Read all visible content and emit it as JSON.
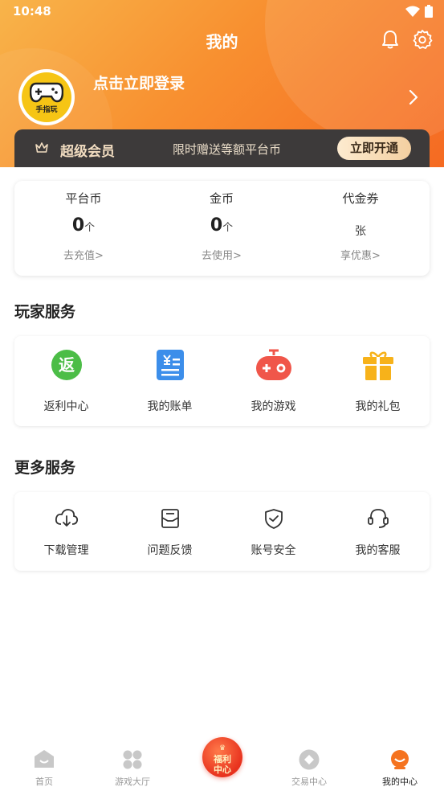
{
  "status_bar": {
    "time": "10:48"
  },
  "header": {
    "title": "我的",
    "login_prompt": "点击立即登录",
    "avatar_label": "手指玩"
  },
  "vip": {
    "title": "超级会员",
    "description": "限时赠送等额平台币",
    "button": "立即开通"
  },
  "wallet": [
    {
      "label": "平台币",
      "value": "0",
      "unit": "个",
      "link": "去充值>"
    },
    {
      "label": "金币",
      "value": "0",
      "unit": "个",
      "link": "去使用>"
    },
    {
      "label": "代金券",
      "value": "",
      "unit": "张",
      "link": "享优惠>"
    }
  ],
  "player_services": {
    "title": "玩家服务",
    "items": [
      {
        "label": "返利中心",
        "icon": "rebate-icon",
        "glyph": "返"
      },
      {
        "label": "我的账单",
        "icon": "bill-icon",
        "glyph": "¥"
      },
      {
        "label": "我的游戏",
        "icon": "gamepad-icon"
      },
      {
        "label": "我的礼包",
        "icon": "gift-icon"
      }
    ]
  },
  "more_services": {
    "title": "更多服务",
    "items": [
      {
        "label": "下载管理",
        "icon": "download-icon"
      },
      {
        "label": "问题反馈",
        "icon": "feedback-icon"
      },
      {
        "label": "账号安全",
        "icon": "shield-icon"
      },
      {
        "label": "我的客服",
        "icon": "headset-icon"
      }
    ]
  },
  "tabbar": {
    "items": [
      {
        "label": "首页",
        "icon": "home-icon"
      },
      {
        "label": "游戏大厅",
        "icon": "grid-icon"
      },
      {
        "label": "",
        "icon": "welfare-badge-icon"
      },
      {
        "label": "交易中心",
        "icon": "trade-icon"
      },
      {
        "label": "我的中心",
        "icon": "profile-icon",
        "active": true
      }
    ],
    "center_badge": "福利\n中心"
  },
  "colors": {
    "header_start": "#f8b44a",
    "header_end": "#f56a22",
    "vip_bar": "#3d3a3a",
    "accent": "#f5731f"
  }
}
